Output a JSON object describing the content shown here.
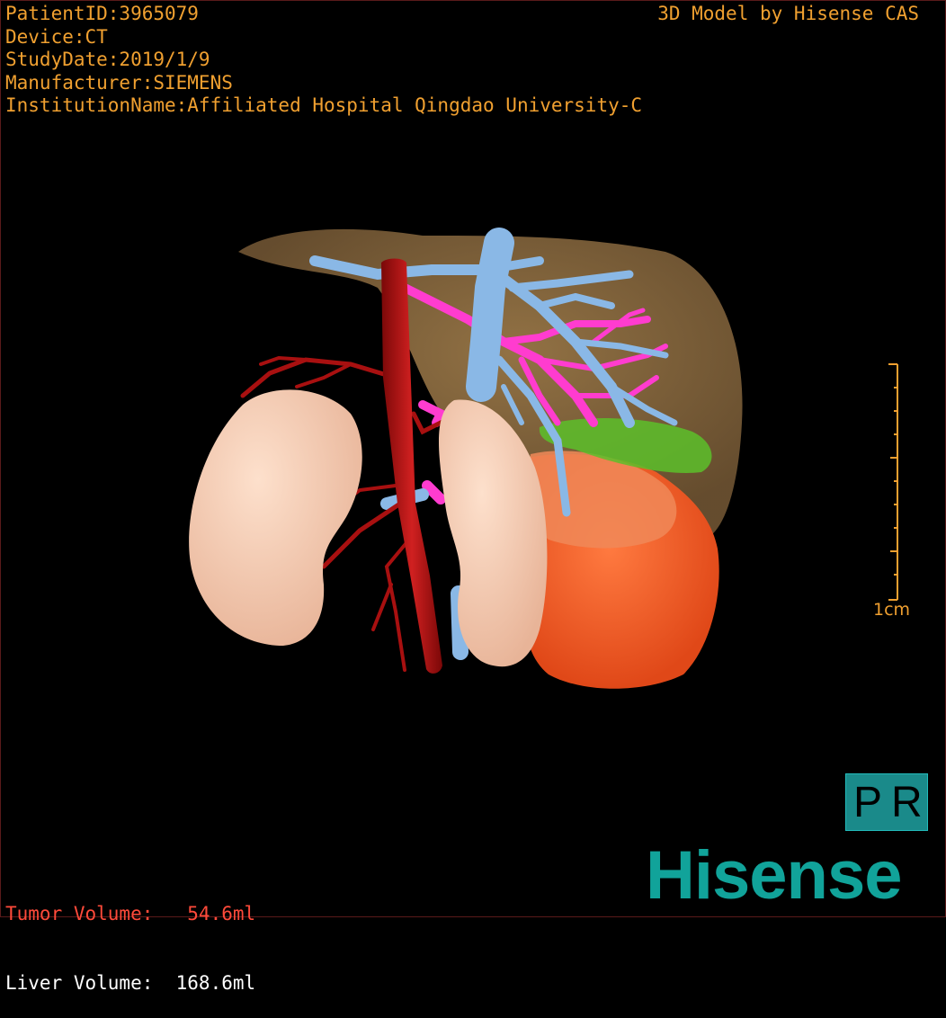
{
  "patient_info": {
    "patient_id": "PatientID:3965079",
    "device": "Device:CT",
    "study_date": "StudyDate:2019/1/9",
    "manufacturer": "Manufacturer:SIEMENS",
    "institution": "InstitutionName:Affiliated Hospital Qingdao University-C"
  },
  "brand_text": "3D Model by Hisense CAS",
  "scale_bar": {
    "label": "1cm"
  },
  "volumes": {
    "tumor": "Tumor Volume:   54.6ml",
    "liver": "Liver Volume:  168.6ml"
  },
  "view_badge": {
    "left": "P",
    "right": "R"
  },
  "logo_text": "Hisense",
  "colors": {
    "overlay_text": "#f0a030",
    "tumor_text": "#ff4a3a",
    "liver": "#8a6a40",
    "artery": "#b01010",
    "portal_vein": "#8ab4e0",
    "hepatic_vein": "#ff40d0",
    "gallbladder": "#60c030",
    "kidney": "#f4c8b0",
    "tumor": "#ff6030",
    "logo": "#11a39a"
  },
  "structures": [
    "liver",
    "tumor",
    "gallbladder",
    "portal-vein",
    "hepatic-vein",
    "aorta",
    "renal-artery",
    "right-kidney",
    "left-kidney",
    "ivc"
  ]
}
